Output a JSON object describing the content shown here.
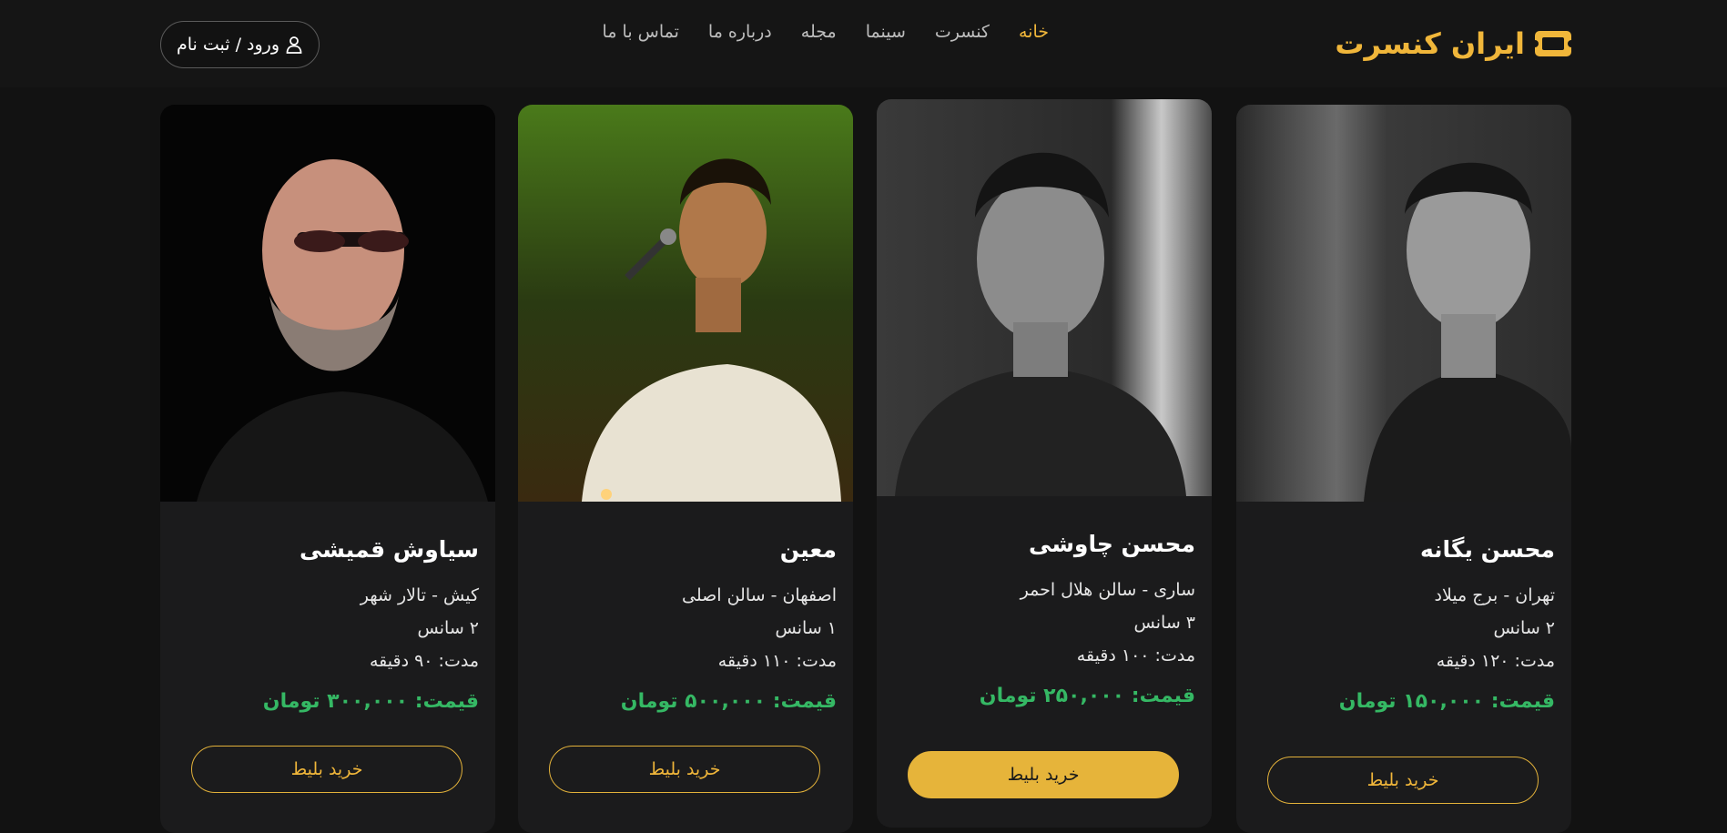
{
  "header": {
    "brand": "ایران کنسرت",
    "brand_icon": "ticket-icon",
    "nav": [
      {
        "label": "خانه",
        "active": true
      },
      {
        "label": "کنسرت",
        "active": false
      },
      {
        "label": "سینما",
        "active": false
      },
      {
        "label": "مجله",
        "active": false
      },
      {
        "label": "درباره ما",
        "active": false
      },
      {
        "label": "تماس با ما",
        "active": false
      }
    ],
    "login_label": "ورود / ثبت نام",
    "login_icon": "user-icon"
  },
  "colors": {
    "accent": "#f0b63a",
    "price": "#35b864",
    "background": "#121212",
    "card": "#1b1b1c"
  },
  "cards": [
    {
      "name": "محسن یگانه",
      "location": "تهران - برج میلاد",
      "sessions": "۲ سانس",
      "duration": "مدت: ۱۲۰ دقیقه",
      "price": "قیمت: ۱۵۰,۰۰۰ تومان",
      "buy_label": "خرید بلیط"
    },
    {
      "name": "محسن چاوشی",
      "location": "ساری - سالن هلال احمر",
      "sessions": "۳ سانس",
      "duration": "مدت: ۱۰۰ دقیقه",
      "price": "قیمت: ۲۵۰,۰۰۰ تومان",
      "buy_label": "خرید بلیط"
    },
    {
      "name": "معین",
      "location": "اصفهان - سالن اصلی",
      "sessions": "۱ سانس",
      "duration": "مدت: ۱۱۰ دقیقه",
      "price": "قیمت: ۵۰۰,۰۰۰ تومان",
      "buy_label": "خرید بلیط"
    },
    {
      "name": "سیاوش قمیشی",
      "location": "کیش - تالار شهر",
      "sessions": "۲ سانس",
      "duration": "مدت: ۹۰ دقیقه",
      "price": "قیمت: ۳۰۰,۰۰۰ تومان",
      "buy_label": "خرید بلیط"
    }
  ]
}
